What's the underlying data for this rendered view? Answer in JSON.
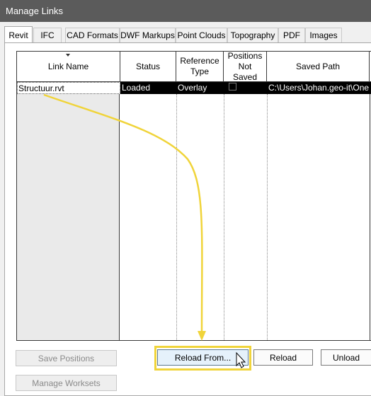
{
  "window": {
    "title": "Manage Links"
  },
  "tabs": [
    {
      "label": "Revit",
      "active": true
    },
    {
      "label": "IFC",
      "active": false
    },
    {
      "label": "CAD Formats",
      "active": false
    },
    {
      "label": "DWF Markups",
      "active": false
    },
    {
      "label": "Point Clouds",
      "active": false
    },
    {
      "label": "Topography",
      "active": false
    },
    {
      "label": "PDF",
      "active": false
    },
    {
      "label": "Images",
      "active": false
    }
  ],
  "table": {
    "columns": [
      "Link Name",
      "Status",
      "Reference Type",
      "Positions Not Saved",
      "Saved Path"
    ],
    "rows": [
      {
        "link_name": "Structuur.rvt",
        "status": "Loaded",
        "reference_type": "Overlay",
        "positions_not_saved": false,
        "saved_path": "C:\\Users\\Johan.geo-it\\One"
      }
    ]
  },
  "buttons": {
    "save_positions": "Save Positions",
    "manage_worksets": "Manage Worksets",
    "reload_from": "Reload From...",
    "reload": "Reload",
    "unload": "Unload"
  },
  "colors": {
    "titlebar": "#5b5b5b",
    "annotation": "#f0d43a",
    "selection": "#000000"
  }
}
